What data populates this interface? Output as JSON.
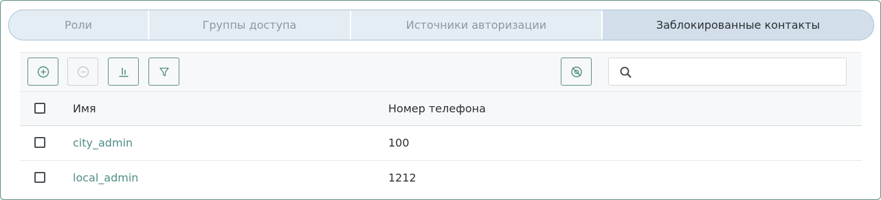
{
  "tabs": [
    {
      "label": "Роли",
      "active": false
    },
    {
      "label": "Группы доступа",
      "active": false
    },
    {
      "label": "Источники авторизации",
      "active": false
    },
    {
      "label": "Заблокированные контакты",
      "active": true
    }
  ],
  "toolbar": {
    "buttons": [
      {
        "icon": "add-circle-icon",
        "enabled": true
      },
      {
        "icon": "remove-circle-icon",
        "enabled": false
      },
      {
        "icon": "columns-icon",
        "enabled": true
      },
      {
        "icon": "filter-icon",
        "enabled": true
      },
      {
        "icon": "hide-icon",
        "enabled": true
      }
    ],
    "search": {
      "value": "",
      "placeholder": "",
      "icon": "search-icon"
    }
  },
  "table": {
    "columns": [
      "Имя",
      "Номер телефона"
    ],
    "rows": [
      {
        "name": "city_admin",
        "phone": "100"
      },
      {
        "name": "local_admin",
        "phone": "1212"
      }
    ]
  },
  "colors": {
    "accent": "#4f8d86",
    "border": "#5f8f89",
    "tab_bg": "#e5edf4",
    "tab_active_bg": "#d2dfeb"
  }
}
